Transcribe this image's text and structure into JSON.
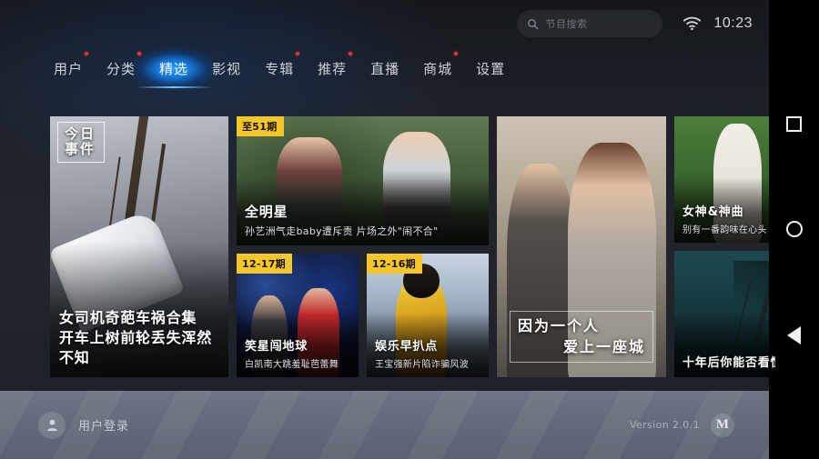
{
  "statusbar": {
    "search": {
      "placeholder": "节目搜索",
      "icon": "search-icon"
    },
    "wifi_icon": "wifi-icon",
    "time": "10:23"
  },
  "nav": {
    "tabs": [
      {
        "label": "用户",
        "active": false,
        "dot": true
      },
      {
        "label": "分类",
        "active": false,
        "dot": true
      },
      {
        "label": "精选",
        "active": true,
        "dot": false
      },
      {
        "label": "影视",
        "active": false,
        "dot": false
      },
      {
        "label": "专辑",
        "active": false,
        "dot": true
      },
      {
        "label": "推荐",
        "active": false,
        "dot": true
      },
      {
        "label": "直播",
        "active": false,
        "dot": false
      },
      {
        "label": "商城",
        "active": false,
        "dot": true
      },
      {
        "label": "设置",
        "active": false,
        "dot": false
      }
    ],
    "accent_color": "#2ba0ff",
    "dot_color": "#e1383c"
  },
  "cards": {
    "crash": {
      "stamp_line1": "今日",
      "stamp_line2": "事件",
      "title_line1": "女司机奇葩车祸合集",
      "title_line2": "开车上树前轮丢失浑然不知"
    },
    "allstar": {
      "badge": "至51期",
      "title": "全明星",
      "subtitle": "孙艺洲气走baby遭斥责 片场之外\"闹不合\""
    },
    "comedy": {
      "badge": "12-17期",
      "title": "笑星闯地球",
      "subtitle": "白凯南大跳羞耻芭蕾舞"
    },
    "gossip": {
      "badge": "12-16期",
      "title": "娱乐早扒点",
      "subtitle": "王宝强新片陷诈骗风波"
    },
    "city": {
      "title_line1": "因为一个人",
      "title_line2": "爱上一座城"
    },
    "goddess": {
      "title": "女神&神曲",
      "subtitle": "别有一番韵味在心头"
    },
    "tenyears": {
      "title": "十年后你能否看懂"
    }
  },
  "bottombar": {
    "avatar_icon": "user-avatar-icon",
    "login_label": "用户登录",
    "version": "Version 2.0.1",
    "logo_text": "M"
  },
  "androidnav": {
    "recents_icon": "square-recents-icon",
    "home_icon": "circle-home-icon",
    "back_icon": "triangle-back-icon"
  }
}
